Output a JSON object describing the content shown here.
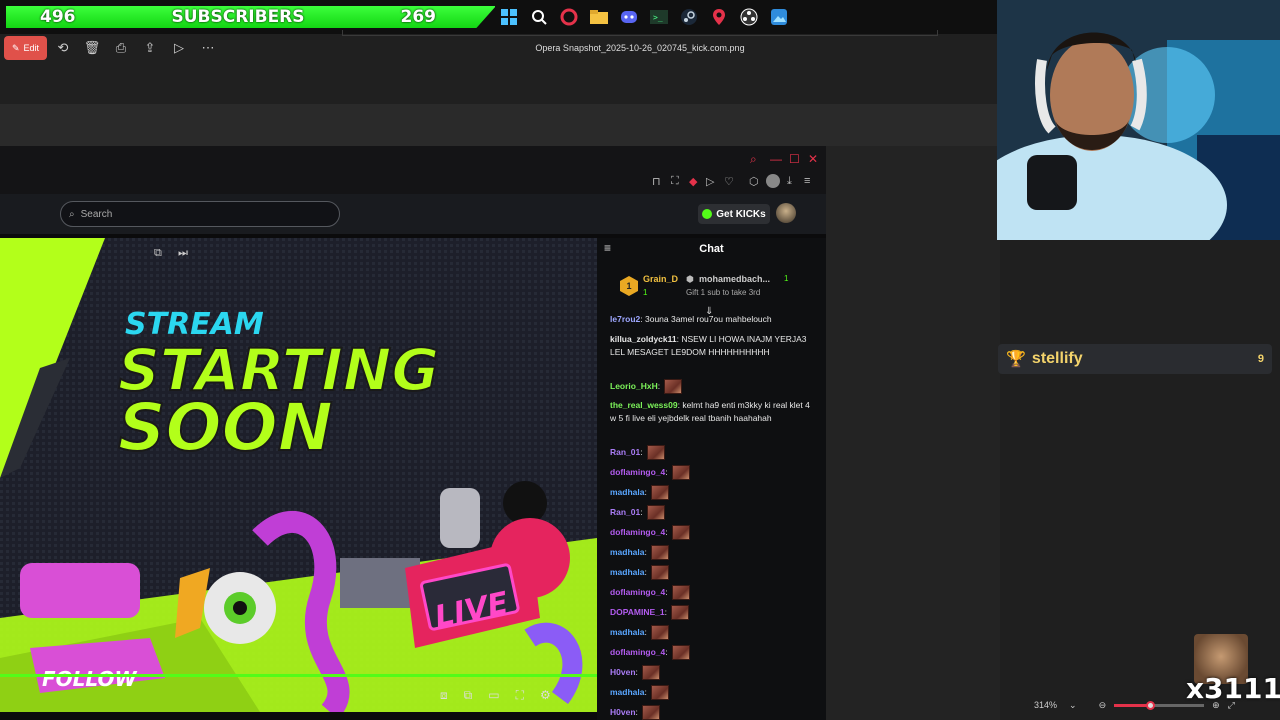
{
  "overlay": {
    "sub_left": "496",
    "sub_label": "SUBSCRIBERS",
    "sub_right": "269",
    "leaderboard_name": "stellify",
    "leaderboard_count": "9",
    "emote_counter": "x3111"
  },
  "viewer": {
    "edit_label": "Edit",
    "filename": "Opera Snapshot_2025-10-26_020745_kick.com.png",
    "zoom": "314%"
  },
  "kick": {
    "search_placeholder": "Search",
    "get_kicks": "Get KICKs",
    "chat_title": "Chat",
    "leader": {
      "rank": "1",
      "name1": "Grain_D",
      "count1": "1",
      "name2": "mohamedbach...",
      "count2": "1",
      "gift_text": "Gift 1 sub to take 3rd"
    },
    "video_text": {
      "line1": "STREAM",
      "line2": "STARTING",
      "line3": "SOON",
      "live": "LIVE",
      "follow": "FOLLOW"
    },
    "messages": [
      {
        "user": "le7rou2",
        "color": "#9ea7ff",
        "text": "3ouna 3amel rou7ou mahbelouch",
        "emote": false
      },
      {
        "user": "killua_zoldyck11",
        "color": "#e8e8e8",
        "text": "NSEW LI HOWA INAJM YERJA3 LEL MESAGET LE9DOM HHHHHHHHHH",
        "emote": false
      },
      {
        "user": "Leorio_HxH",
        "color": "#7cf25a",
        "text": "",
        "emote": true
      },
      {
        "user": "the_real_wess09",
        "color": "#7cf25a",
        "text": "kelmt ha9 enti m3kky ki real klet 4 w 5 fi live eli yejbdelk real tbanih haahahah",
        "emote": false
      },
      {
        "user": "Ran_01",
        "color": "#a97cf5",
        "text": "",
        "emote": true
      },
      {
        "user": "doflamingo_4",
        "color": "#b35cf0",
        "text": "",
        "emote": true
      },
      {
        "user": "madhala",
        "color": "#5aa6ff",
        "text": "",
        "emote": true
      },
      {
        "user": "Ran_01",
        "color": "#a97cf5",
        "text": "",
        "emote": true
      },
      {
        "user": "doflamingo_4",
        "color": "#b35cf0",
        "text": "",
        "emote": true
      },
      {
        "user": "madhala",
        "color": "#5aa6ff",
        "text": "",
        "emote": true
      },
      {
        "user": "madhala",
        "color": "#5aa6ff",
        "text": "",
        "emote": true
      },
      {
        "user": "doflamingo_4",
        "color": "#b35cf0",
        "text": "",
        "emote": true
      },
      {
        "user": "DOPAMINE_1",
        "color": "#b35cf0",
        "text": "",
        "emote": true
      },
      {
        "user": "madhala",
        "color": "#5aa6ff",
        "text": "",
        "emote": true
      },
      {
        "user": "doflamingo_4",
        "color": "#b35cf0",
        "text": "",
        "emote": true
      },
      {
        "user": "H0ven",
        "color": "#a97cf5",
        "text": "",
        "emote": true
      },
      {
        "user": "madhala",
        "color": "#5aa6ff",
        "text": "",
        "emote": true
      },
      {
        "user": "H0ven",
        "color": "#a97cf5",
        "text": "",
        "emote": true
      }
    ]
  }
}
